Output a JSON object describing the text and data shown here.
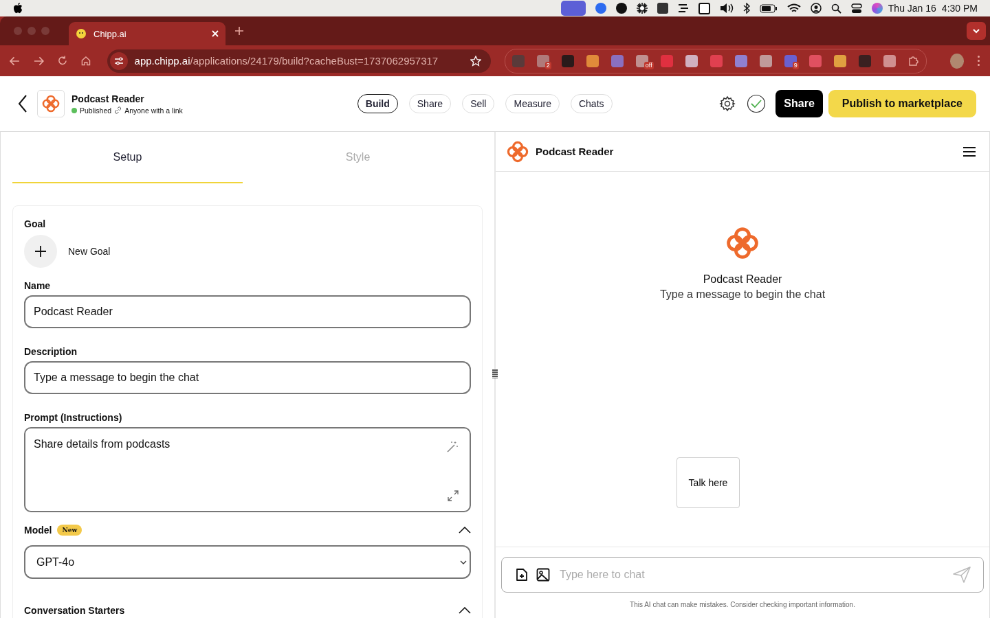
{
  "menu_bar": {
    "date": "Thu Jan 16",
    "time": "4:30 PM"
  },
  "browser": {
    "tab_title": "Chipp.ai",
    "url_host": "app.chipp.ai",
    "url_path": "/applications/24179/build?cacheBust=1737062957317",
    "extensions": [
      {
        "color": "#5a3a3a"
      },
      {
        "color": "#b07a7a",
        "badge": "2"
      },
      {
        "color": "#2a1a1a"
      },
      {
        "color": "#e08a3a"
      },
      {
        "color": "#8a70c0"
      },
      {
        "color": "#c09090",
        "badge": "off"
      },
      {
        "color": "#e03040"
      },
      {
        "color": "#d0b0c0"
      },
      {
        "color": "#e04050"
      },
      {
        "color": "#9080d0"
      },
      {
        "color": "#c09a9a"
      },
      {
        "color": "#6a60d0",
        "badge": "9"
      },
      {
        "color": "#e05060"
      },
      {
        "color": "#e0a040"
      },
      {
        "color": "#3a2020"
      },
      {
        "color": "#d09090"
      }
    ]
  },
  "app_header": {
    "name": "Podcast Reader",
    "status": "Published",
    "visibility": "Anyone with a link",
    "nav": [
      {
        "label": "Build",
        "selected": true
      },
      {
        "label": "Share",
        "selected": false
      },
      {
        "label": "Sell",
        "selected": false
      },
      {
        "label": "Measure",
        "selected": false
      },
      {
        "label": "Chats",
        "selected": false
      }
    ],
    "share_button": "Share",
    "publish_button": "Publish to marketplace"
  },
  "tabs": [
    {
      "label": "Setup",
      "selected": true
    },
    {
      "label": "Style",
      "selected": false
    }
  ],
  "form": {
    "goal_label": "Goal",
    "new_goal": "New Goal",
    "fields": [
      {
        "kind": "input",
        "label": "Name",
        "value": "Podcast Reader"
      },
      {
        "kind": "input",
        "label": "Description",
        "value": "Type a message to begin the chat"
      },
      {
        "kind": "textarea",
        "label": "Prompt (Instructions)",
        "value": "Share details from podcasts"
      },
      {
        "kind": "select",
        "label": "Model",
        "badge": "New",
        "expanded": true,
        "value": "GPT-4o"
      }
    ],
    "sections": [
      {
        "label": "Conversation Starters",
        "expanded": true
      }
    ]
  },
  "preview": {
    "title": "Podcast Reader",
    "welcome_title": "Podcast Reader",
    "welcome_text": "Type a message to begin the chat",
    "suggestion": "Talk here",
    "input_placeholder": "Type here to chat",
    "disclaimer": "This AI chat can make mistakes. Consider checking important information."
  }
}
